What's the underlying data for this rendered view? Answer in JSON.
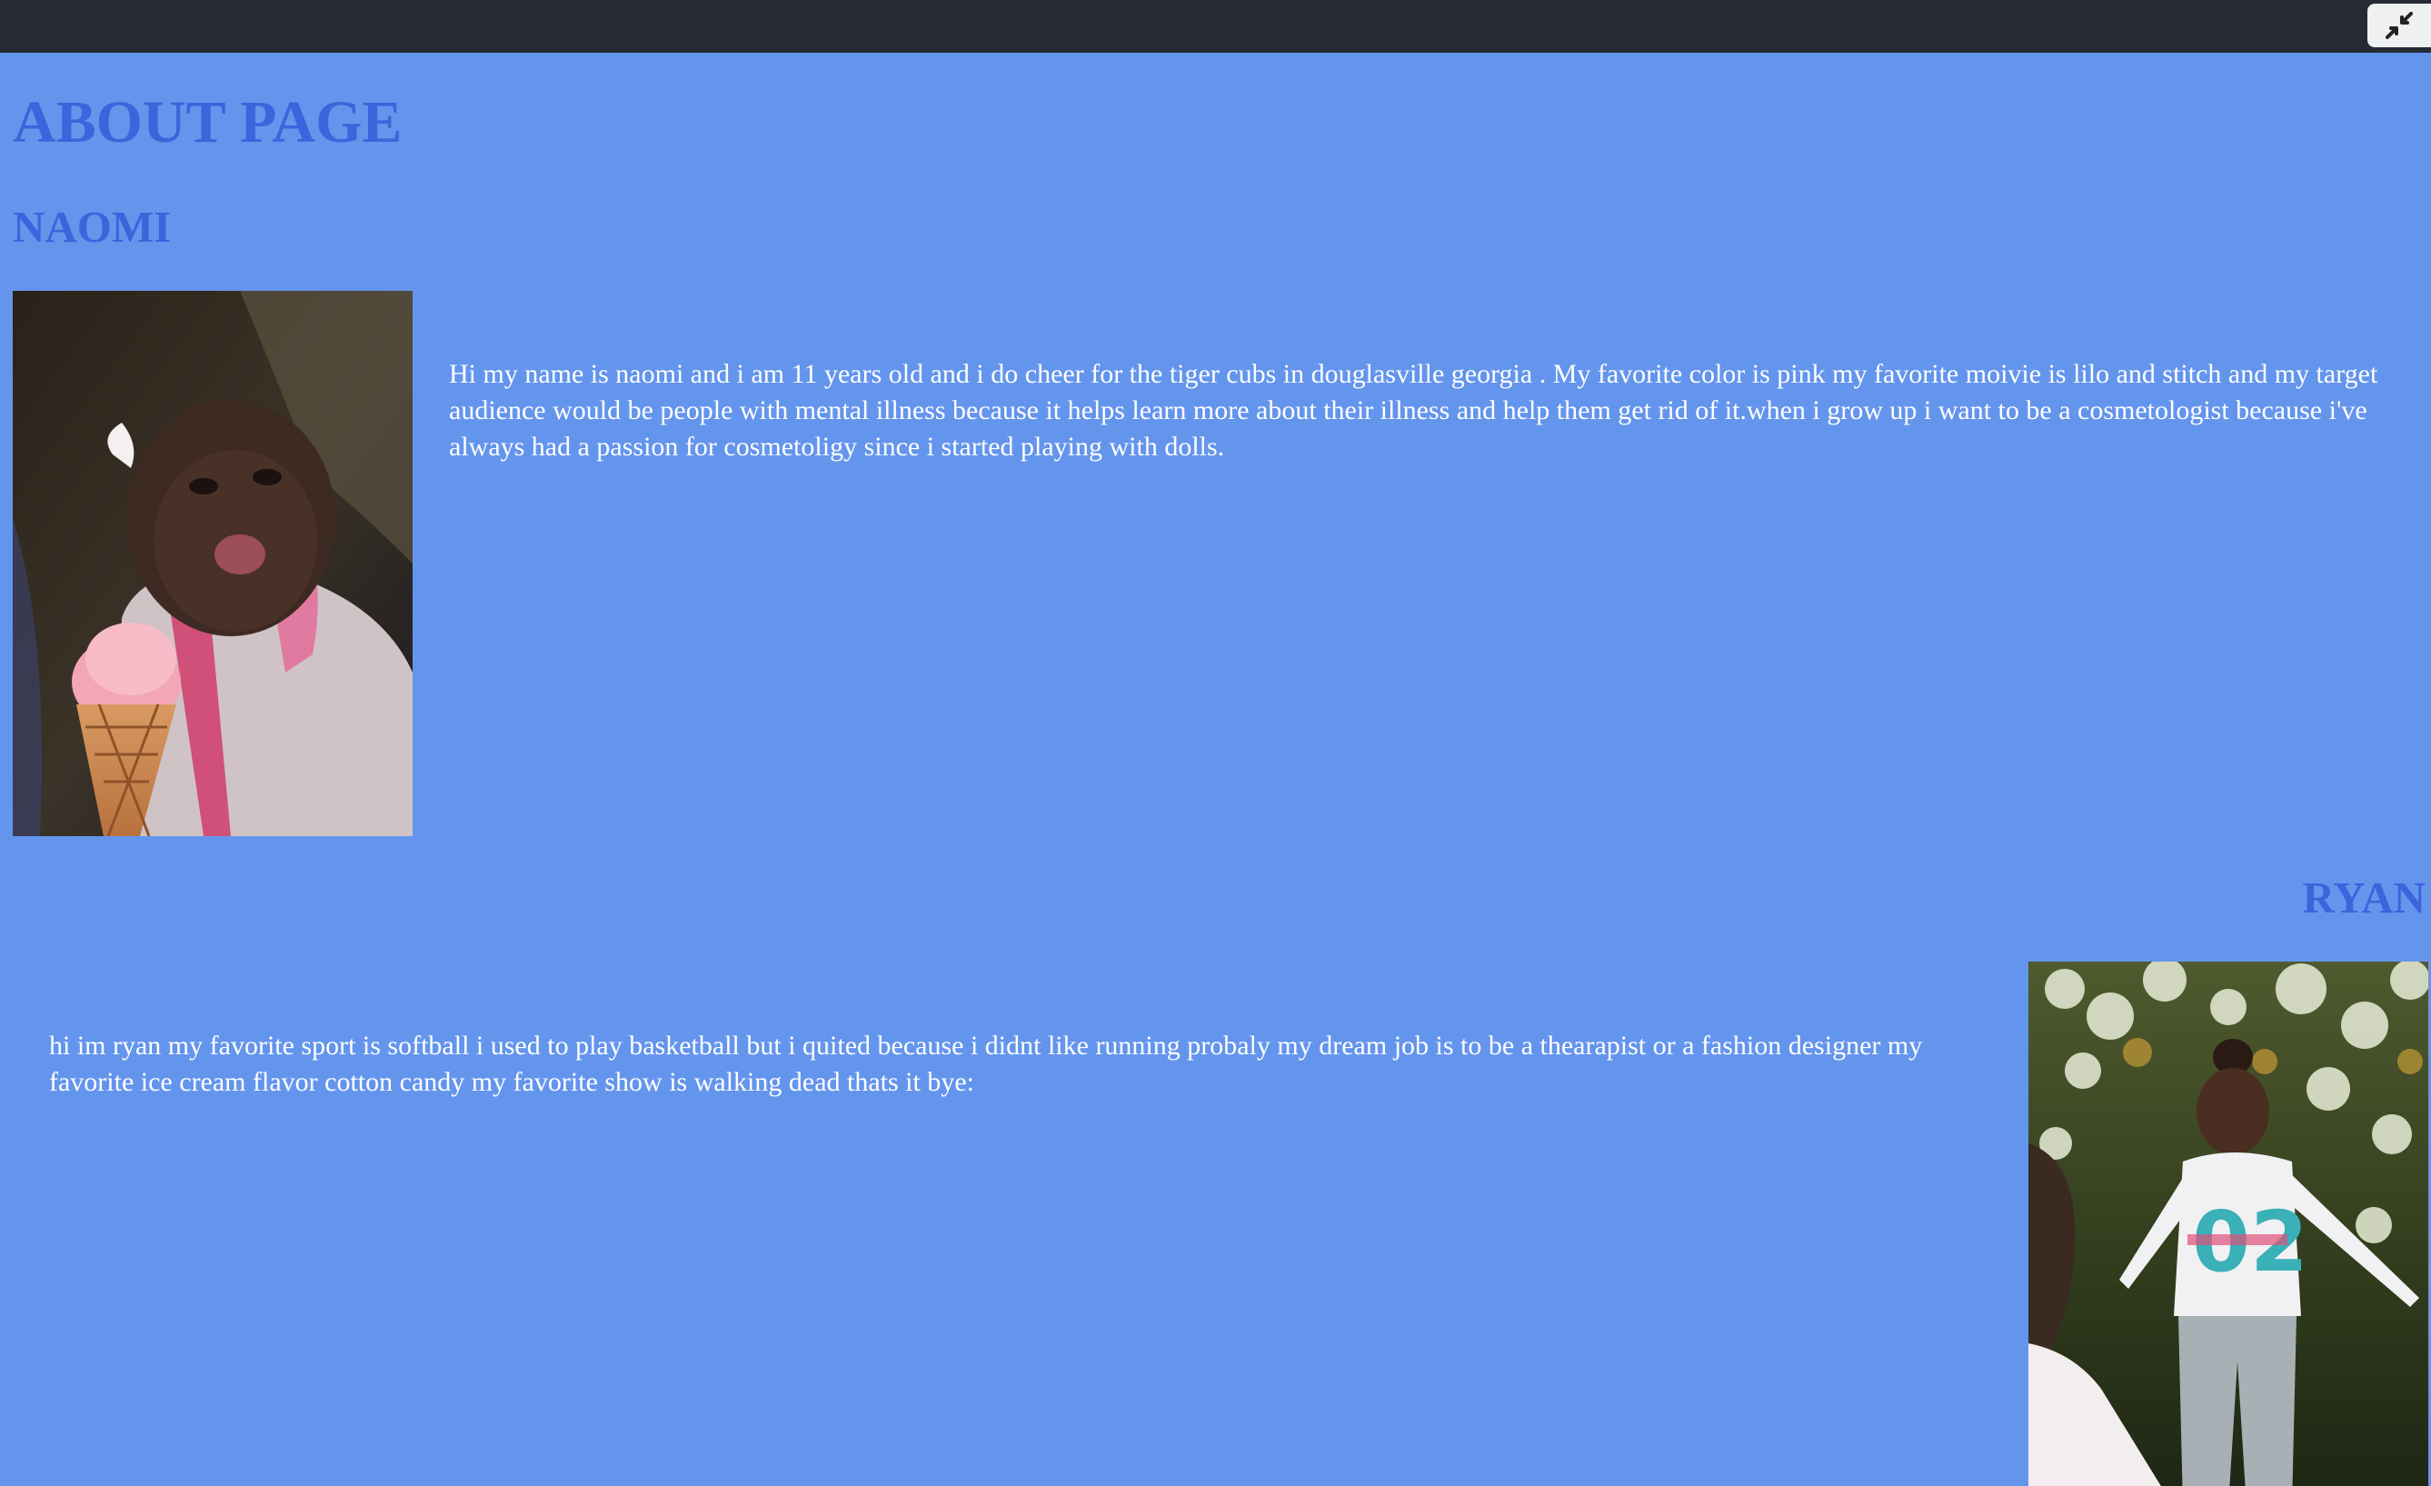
{
  "page": {
    "title": "ABOUT PAGE"
  },
  "toolbar": {
    "exit_fullscreen_icon": "exit-fullscreen-icon"
  },
  "profiles": [
    {
      "name": "NAOMI",
      "bio": "Hi my name is naomi and i am 11 years old and i do cheer for the tiger cubs in douglasville georgia . My favorite color is pink my favorite moivie is lilo and stitch and my target audience would be people with mental illness because it helps learn more about their illness and help them get rid of it.when i grow up i want to be a cosmetologist because i've always had a passion for cosmetoligy since i started playing with dolls."
    },
    {
      "name": "RYAN",
      "bio": "hi im ryan my favorite sport is softball i used to play basketball but i quited because i didnt like running probaly my dream job is to be a thearapist or a fashion designer my favorite ice cream flavor cotton candy my favorite show is walking dead thats it bye:"
    }
  ],
  "colors": {
    "background": "#6495ED",
    "heading": "#3C64DC",
    "text": "#FFFFFF",
    "topbar": "#262B33"
  }
}
